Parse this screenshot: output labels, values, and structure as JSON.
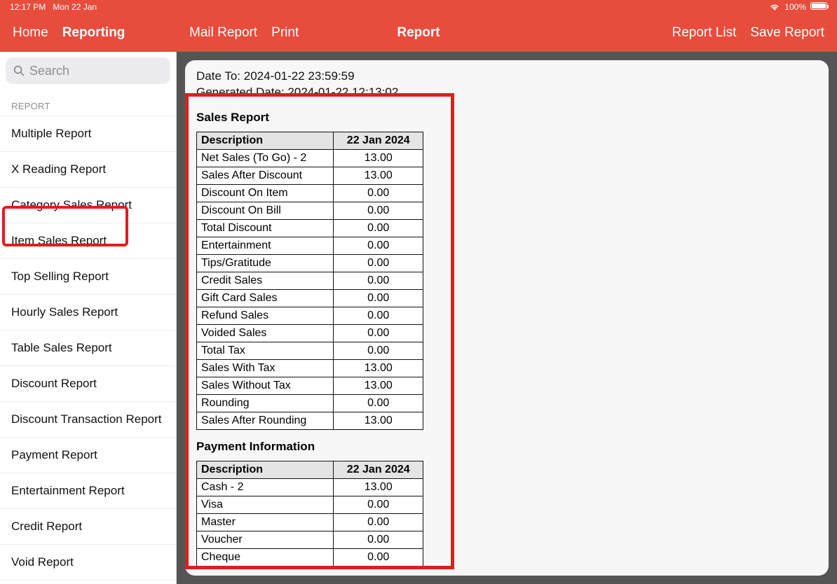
{
  "statusbar": {
    "time": "12:17 PM",
    "date": "Mon 22 Jan",
    "battery": "100%"
  },
  "toolbar": {
    "home": "Home",
    "reporting": "Reporting",
    "mail_report": "Mail Report",
    "print": "Print",
    "title": "Report",
    "report_list": "Report List",
    "save_report": "Save Report"
  },
  "sidebar": {
    "search_placeholder": "Search",
    "section_label": "REPORT",
    "items": [
      "Multiple Report",
      "X Reading Report",
      "Category Sales Report",
      "Item Sales Report",
      "Top Selling Report",
      "Hourly Sales Report",
      "Table Sales Report",
      "Discount Report",
      "Discount Transaction Report",
      "Payment Report",
      "Entertainment Report",
      "Credit Report",
      "Void Report"
    ]
  },
  "report": {
    "date_to_label": "Date To: ",
    "date_to": "2024-01-22 23:59:59",
    "generated_label": "Generated Date: ",
    "generated": "2024-01-22 12:13:02",
    "sales_title": "Sales Report",
    "payment_title": "Payment Information",
    "col_desc": "Description",
    "col_date": "22 Jan 2024",
    "sales_rows": [
      {
        "desc": "Net Sales (To Go) - 2",
        "val": "13.00"
      },
      {
        "desc": "Sales After Discount",
        "val": "13.00"
      },
      {
        "desc": "Discount On Item",
        "val": "0.00"
      },
      {
        "desc": "Discount On Bill",
        "val": "0.00"
      },
      {
        "desc": "Total Discount",
        "val": "0.00"
      },
      {
        "desc": "Entertainment",
        "val": "0.00"
      },
      {
        "desc": "Tips/Gratitude",
        "val": "0.00"
      },
      {
        "desc": "Credit Sales",
        "val": "0.00"
      },
      {
        "desc": "Gift Card Sales",
        "val": "0.00"
      },
      {
        "desc": "Refund Sales",
        "val": "0.00"
      },
      {
        "desc": "Voided Sales",
        "val": "0.00"
      },
      {
        "desc": "Total Tax",
        "val": "0.00"
      },
      {
        "desc": "Sales With Tax",
        "val": "13.00"
      },
      {
        "desc": "Sales Without Tax",
        "val": "13.00"
      },
      {
        "desc": "Rounding",
        "val": "0.00"
      },
      {
        "desc": "Sales After Rounding",
        "val": "13.00"
      }
    ],
    "payment_rows": [
      {
        "desc": "Cash - 2",
        "val": "13.00"
      },
      {
        "desc": "Visa",
        "val": "0.00"
      },
      {
        "desc": "Master",
        "val": "0.00"
      },
      {
        "desc": "Voucher",
        "val": "0.00"
      },
      {
        "desc": "Cheque",
        "val": "0.00"
      }
    ]
  }
}
